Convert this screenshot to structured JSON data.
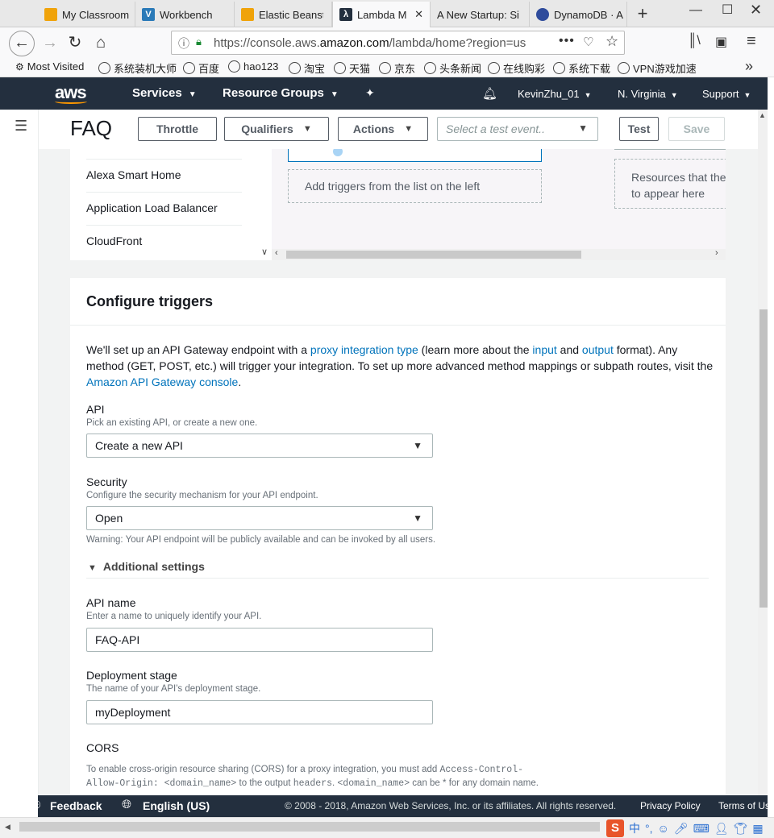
{
  "browser": {
    "tabs": [
      {
        "label": "My Classroom",
        "icon": "aws-box-icon",
        "color": "#f0a30a",
        "active": false
      },
      {
        "label": "Workbench",
        "icon": "workbench-icon",
        "color": "#2a7ab8",
        "active": false
      },
      {
        "label": "Elastic Beanstalk",
        "icon": "aws-box-icon",
        "color": "#f0a30a",
        "active": false
      },
      {
        "label": "Lambda M",
        "icon": "lambda-icon",
        "color": "#232f3e",
        "active": true
      },
      {
        "label": "A New Startup: Si",
        "icon": "",
        "color": "",
        "active": false
      },
      {
        "label": "DynamoDB · A",
        "icon": "dynamodb-icon",
        "color": "#2e4b9c",
        "active": false
      }
    ],
    "url_prefix": "https://console.aws.",
    "url_domain": "amazon.com",
    "url_suffix": "/lambda/home?region=us",
    "bookmarks": [
      "Most Visited",
      "系统装机大师",
      "百度",
      "hao123",
      "淘宝",
      "天猫",
      "京东",
      "头条新闻",
      "在线购彩",
      "系统下载",
      "VPN游戏加速"
    ]
  },
  "aws_header": {
    "logo": "aws",
    "services": "Services",
    "resource_groups": "Resource Groups",
    "user": "KevinZhu_01",
    "region": "N. Virginia",
    "support": "Support"
  },
  "function_bar": {
    "title": "FAQ",
    "throttle": "Throttle",
    "qualifiers": "Qualifiers",
    "actions": "Actions",
    "test_event_placeholder": "Select a test event..",
    "test": "Test",
    "save": "Save"
  },
  "designer": {
    "trigger_list": [
      "Alexa Smart Home",
      "Application Load Balancer",
      "CloudFront"
    ],
    "add_triggers_hint": "Add triggers from the list on the left",
    "resources_hint": "Resources that the",
    "resources_hint_2": "to appear here"
  },
  "configure_triggers": {
    "title": "Configure triggers",
    "desc_part1": "We'll set up an API Gateway endpoint with a ",
    "desc_link1": "proxy integration type",
    "desc_part2": " (learn more about the ",
    "desc_link2": "input",
    "desc_part3": " and ",
    "desc_link3": "output",
    "desc_part4": " format). Any method (GET, POST, etc.) will trigger your integration. To set up more advanced method mappings or subpath routes, visit the ",
    "desc_link4": "Amazon API Gateway console",
    "desc_part5": ".",
    "api_label": "API",
    "api_hint": "Pick an existing API, or create a new one.",
    "api_value": "Create a new API",
    "security_label": "Security",
    "security_hint": "Configure the security mechanism for your API endpoint.",
    "security_value": "Open",
    "security_warning": "Warning: Your API endpoint will be publicly available and can be invoked by all users.",
    "additional_settings": "Additional settings",
    "api_name_label": "API name",
    "api_name_hint": "Enter a name to uniquely identify your API.",
    "api_name_value": "FAQ-API",
    "stage_label": "Deployment stage",
    "stage_hint": "The name of your API's deployment stage.",
    "stage_value": "myDeployment",
    "cors_label": "CORS",
    "cors_desc_1": "To enable cross-origin resource sharing (CORS) for a proxy integration, you must add ",
    "cors_code_1": "Access-Control-Allow-Origin: <domain_name>",
    "cors_desc_2": " to the output ",
    "cors_code_2": "headers",
    "cors_desc_3": ". ",
    "cors_code_3": "<domain_name>",
    "cors_desc_4": " can be * for any domain name."
  },
  "footer": {
    "feedback": "Feedback",
    "language": "English (US)",
    "copyright": "© 2008 - 2018, Amazon Web Services, Inc. or its affiliates. All rights reserved.",
    "privacy": "Privacy Policy",
    "terms": "Terms of Us"
  },
  "ime": {
    "logo": "S",
    "mode": "中"
  }
}
